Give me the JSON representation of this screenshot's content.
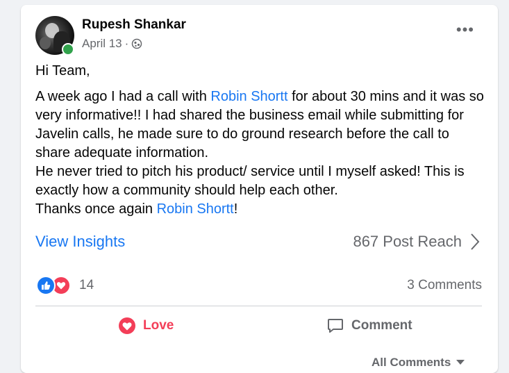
{
  "post": {
    "author": "Rupesh Shankar",
    "date": "April 13",
    "separator": "·",
    "greeting": "Hi Team,",
    "line1_a": "A week ago I had a call with ",
    "mention": "Robin Shortt",
    "line1_b": " for about 30 mins and it was so very informative!! I had shared the business email while submitting for Javelin calls, he made sure to do ground research before the call to share adequate information.",
    "line2": "He never tried to pitch his product/ service until I myself asked! This is exactly how a community should help each other.",
    "line3_a": "Thanks once again ",
    "line3_b": "!",
    "more_label": "•••"
  },
  "insights": {
    "view_label": "View Insights",
    "reach_label": "867 Post Reach"
  },
  "reactions": {
    "count": "14",
    "comments": "3 Comments"
  },
  "actions": {
    "love_label": "Love",
    "comment_label": "Comment"
  },
  "footer": {
    "all_comments": "All Comments"
  },
  "icons": {
    "globe": "globe-icon",
    "like": "like-icon",
    "love": "heart-icon",
    "comment": "comment-icon",
    "chevron": "chevron-right-icon"
  },
  "colors": {
    "accent": "#1877f2",
    "love": "#f33e58",
    "online": "#31a24c",
    "muted": "#65676b"
  }
}
